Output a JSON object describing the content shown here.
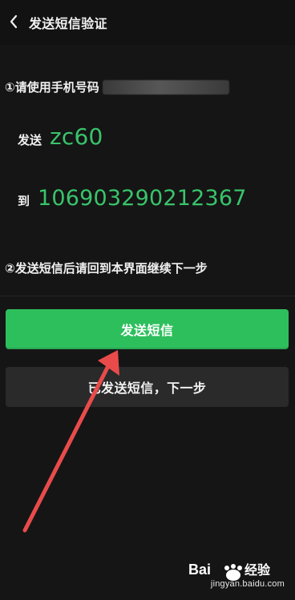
{
  "header": {
    "title": "发送短信验证",
    "back_icon": "chevron-left-icon"
  },
  "step1": {
    "prefix": "①请使用手机号码",
    "phone_redacted": true
  },
  "sms": {
    "send_label": "发送",
    "code": "zc60",
    "to_label": "到",
    "number": "106903290212367"
  },
  "step2": {
    "text": "②发送短信后请回到本界面继续下一步"
  },
  "buttons": {
    "send": "发送短信",
    "next": "已发送短信，下一步"
  },
  "annotation": {
    "arrow_color": "#e94b4b",
    "target": "send-sms-button"
  },
  "watermark": {
    "brand": "Bai 经验",
    "url": "jingyan.baidu.com"
  },
  "colors": {
    "accent": "#2ebf5d",
    "text_green": "#39c46b",
    "background": "#151515"
  }
}
